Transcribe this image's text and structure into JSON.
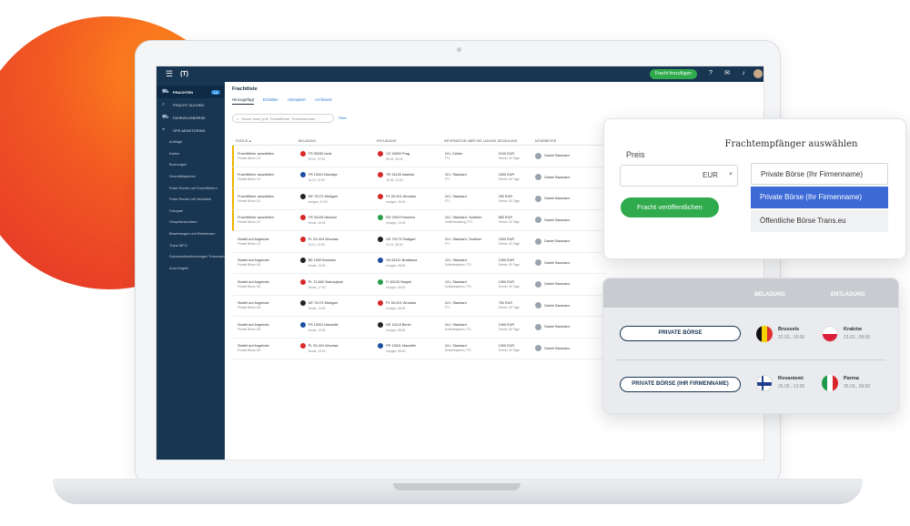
{
  "topbar": {
    "add_button": "Fracht hinzufügen",
    "badge1": "1",
    "badge2": "4"
  },
  "sidebar": {
    "items": [
      {
        "label": "FRACHTEN",
        "badge": "14"
      },
      {
        "label": "FRACHT SUCHEN"
      },
      {
        "label": "FAHRZEUGBÖRSE"
      },
      {
        "label": "GPS-MONITORING"
      }
    ],
    "sub_items": [
      "Aufträge",
      "Karten",
      "Buchungen",
      "Geschäftspartner",
      "Feste Routen mit Frachtführern",
      "Feste Routen mit Verladern",
      "Fuhrpark",
      "Gesprächsnotizen",
      "Bewertungen und Referenzen",
      "Trans.INFO",
      "Dokumentbestimmungen Transcash",
      "Auto-Regeln"
    ]
  },
  "content": {
    "title": "Frachtliste",
    "tabs": [
      "Hinzugefügt",
      "Erhalten",
      "Akzeptiert",
      "Archiviert"
    ],
    "search_placeholder": "Suche nach (z.B. Frachtführer, Frachtnummer ...",
    "filter": "Filter",
    "headers": [
      "STATUS ▲",
      "BELADUNG",
      "ENTLADUNG",
      "INFORMATION ÜBER DIE LADUNG",
      "BEZAHLUNG",
      "MITARBEITER"
    ],
    "rows": [
      {
        "status": "Frachtführer auswählen",
        "status_sub": "Private Börse 1/2",
        "load": "TR 35250 İzmir",
        "load_date": "02.02, 07:00",
        "unload": "CZ 18000 Prag",
        "unload_date": "05.02, 09:00",
        "info": "24 t, Kühler",
        "info_sub": "FTL",
        "price": "2100 EUR",
        "price_sub": "Termin: 30 Tage",
        "emp": "Daniel Baumann",
        "flag1": "#d62828",
        "flag2": "#d62828"
      },
      {
        "status": "Frachtführer auswählen",
        "status_sub": "Private Börse 1/2",
        "load": "FR 13001 Marsilya",
        "load_date": "14.02, 07:00",
        "unload": "TR 34126 İstanbul",
        "unload_date": "15.02, 12:00",
        "info": "10 t, Standard",
        "info_sub": "FTL",
        "price": "1500 EUR",
        "price_sub": "Termin: 30 Tage",
        "emp": "Daniel Baumann",
        "flag1": "#1e4fa3",
        "flag2": "#d62828"
      },
      {
        "status": "Frachtführer auswählen",
        "status_sub": "Private Börse 1/2",
        "load": "DE 70173 Stuttgart",
        "load_date": "morgen, 17:00",
        "unload": "PL 50-001 Wrocław",
        "unload_date": "morgen, 18:00",
        "info": "24 t, Standard",
        "info_sub": "FTL",
        "price": "250 EUR",
        "price_sub": "Termin: 30 Tage",
        "emp": "Daniel Baumann",
        "flag1": "#222",
        "flag2": "#d62828"
      },
      {
        "status": "Frachtführer auswählen",
        "status_sub": "Private Börse 1/2",
        "load": "TR 34126 İstanbul",
        "load_date": "Heute, 16:00",
        "unload": "BG 2004 Polomica",
        "unload_date": "morgen, 13:00",
        "info": "24 t, Standard, Tautliner",
        "info_sub": "Seitenbeladung, FTL",
        "price": "850 EUR",
        "price_sub": "Termin: 30 Tage",
        "emp": "Daniel Baumann",
        "flag1": "#d62828",
        "flag2": "#2a9d4a"
      },
      {
        "status": "Startet auf Angebote",
        "status_sub": "Private Börse 1/2",
        "load": "PL 53-424 Wrocław",
        "load_date": "02.01, 07:00",
        "unload": "DE 70173 Stuttgart",
        "unload_date": "02.01, 08:00",
        "info": "24 t, Standard, Tautliner",
        "info_sub": "FTL",
        "price": "1500 EUR",
        "price_sub": "Termin: 30 Tage",
        "emp": "Daniel Baumann",
        "flag1": "#d62828",
        "flag2": "#222"
      },
      {
        "status": "Startet auf Angebote",
        "status_sub": "Private Börse 4/5",
        "load": "BE 1000 Brussels",
        "load_date": "Heute, 13:00",
        "unload": "SK 81101 Bratislava",
        "unload_date": "morgen, 08:00",
        "info": "13 t, Standard",
        "info_sub": "Schiebeplanen, FTL",
        "price": "1390 EUR",
        "price_sub": "Termin: 30 Tage",
        "emp": "Daniel Baumann",
        "flag1": "#222",
        "flag2": "#1e4fa3"
      },
      {
        "status": "Startet auf Angebote",
        "status_sub": "Private Börse 3/5",
        "load": "PL 73-600 Świnoujście",
        "load_date": "Heute, 17:00",
        "unload": "IT 80125 Neapel",
        "unload_date": "morgen, 08:00",
        "info": "13 t, Standard",
        "info_sub": "Schiebeplanen, FTL",
        "price": "1390 EUR",
        "price_sub": "Termin: 30 Tage",
        "emp": "Daniel Baumann",
        "flag1": "#d62828",
        "flag2": "#2a9d4a"
      },
      {
        "status": "Startet auf Angebote",
        "status_sub": "Private Börse 4/5",
        "load": "DE 70173 Stuttgart",
        "load_date": "Heute, 13:00",
        "unload": "PL 50-001 Wrocław",
        "unload_date": "morgen, 08:00",
        "info": "24 t, Standard",
        "info_sub": "FTL",
        "price": "750 EUR",
        "price_sub": "Termin: 30 Tage",
        "emp": "Daniel Baumann",
        "flag1": "#222",
        "flag2": "#d62828"
      },
      {
        "status": "Startet auf Angebote",
        "status_sub": "Private Börse 3/5",
        "load": "FR 13001 Marseille",
        "load_date": "Heute, 13:00",
        "unload": "DE 10115 Berlin",
        "unload_date": "morgen, 08:00",
        "info": "24 t, Standard",
        "info_sub": "Schiebeplanen, FTL",
        "price": "1390 EUR",
        "price_sub": "Termin: 30 Tage",
        "emp": "Daniel Baumann",
        "flag1": "#1e4fa3",
        "flag2": "#222"
      },
      {
        "status": "Startet auf Angebote",
        "status_sub": "Private Börse 3/5",
        "load": "PL 53-424 Wrocław",
        "load_date": "Heute, 13:00",
        "unload": "FR 13001 Marseille",
        "unload_date": "morgen, 08:00",
        "info": "24 t, Standard",
        "info_sub": "Schiebeplanen, FTL",
        "price": "1390 EUR",
        "price_sub": "Termin: 30 Tage",
        "emp": "Daniel Baumann",
        "flag1": "#d62828",
        "flag2": "#1e4fa3"
      }
    ]
  },
  "popup_recipient": {
    "title": "Frachtempfänger auswählen",
    "price_label": "Preis",
    "currency": "EUR",
    "publish_button": "Fracht veröffentlichen",
    "options": [
      "Private Börse (Ihr Firmenname)",
      "Private Börse (Ihr Firmenname)",
      "Öffentliche Börse Trans.eu"
    ]
  },
  "popup_exchange": {
    "col_load": "BELADUNG",
    "col_unload": "ENTLADUNG",
    "rows": [
      {
        "pill": "PRIVATE BÖRSE",
        "from_city": "Brussels",
        "from_date": "22.03., 10:00",
        "to_city": "Kraków",
        "to_date": "23.03., 08:00"
      },
      {
        "pill": "PRIVATE BÖRSE (IHR FIRMENNAME)",
        "from_city": "Rovaniemi",
        "from_date": "25.05., 12:00",
        "to_city": "Parma",
        "to_date": "26.03., 08:00"
      }
    ]
  }
}
